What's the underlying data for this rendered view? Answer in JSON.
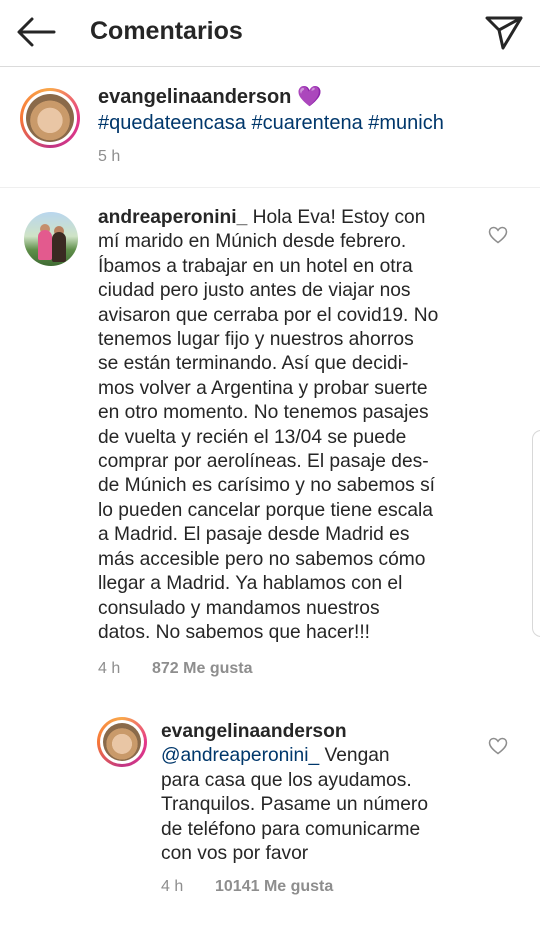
{
  "header": {
    "title": "Comentarios",
    "back_icon": "arrow-left-icon",
    "send_icon": "paper-plane-icon"
  },
  "post": {
    "username": "evangelinaanderson",
    "emoji": "💜",
    "hashtags": [
      "#quedateencasa",
      "#cuarentena",
      "#munich"
    ],
    "time": "5 h"
  },
  "comments": [
    {
      "username": "andreaperonini_",
      "text_lines": [
        " Hola Eva! Estoy con",
        "mí marido en Múnich desde febrero.",
        "Íbamos a trabajar  en un hotel en otra",
        "ciudad pero justo antes de viajar nos",
        "avisaron que cerraba por el covid19. No",
        "tenemos lugar fijo y nuestros ahorros",
        "se están terminando. Así que decidi-",
        "mos volver a Argentina y probar suerte",
        "en otro momento. No tenemos pasajes",
        "de vuelta y recién el 13/04 se puede",
        "comprar por aerolíneas. El pasaje des-",
        "de Múnich es carísimo y no sabemos sí",
        "lo pueden cancelar porque tiene escala",
        "a Madrid. El pasaje desde Madrid es",
        "más accesible pero no sabemos cómo",
        "llegar a Madrid. Ya hablamos con el",
        "consulado y mandamos nuestros",
        "datos. No sabemos que hacer!!!"
      ],
      "time": "4 h",
      "likes": "872 Me gusta"
    },
    {
      "username": "evangelinaanderson",
      "mention": "@andreaperonini_",
      "text_lines": [
        " Vengan",
        "para casa que los ayudamos.",
        "Tranquilos. Pasame un número",
        "de teléfono para comunicarme",
        "con vos por favor"
      ],
      "time": "4 h",
      "likes": "10141 Me gusta"
    }
  ],
  "colors": {
    "text": "#262626",
    "secondary": "#8e8e8e",
    "link": "#00376b",
    "divider": "#efefef"
  }
}
